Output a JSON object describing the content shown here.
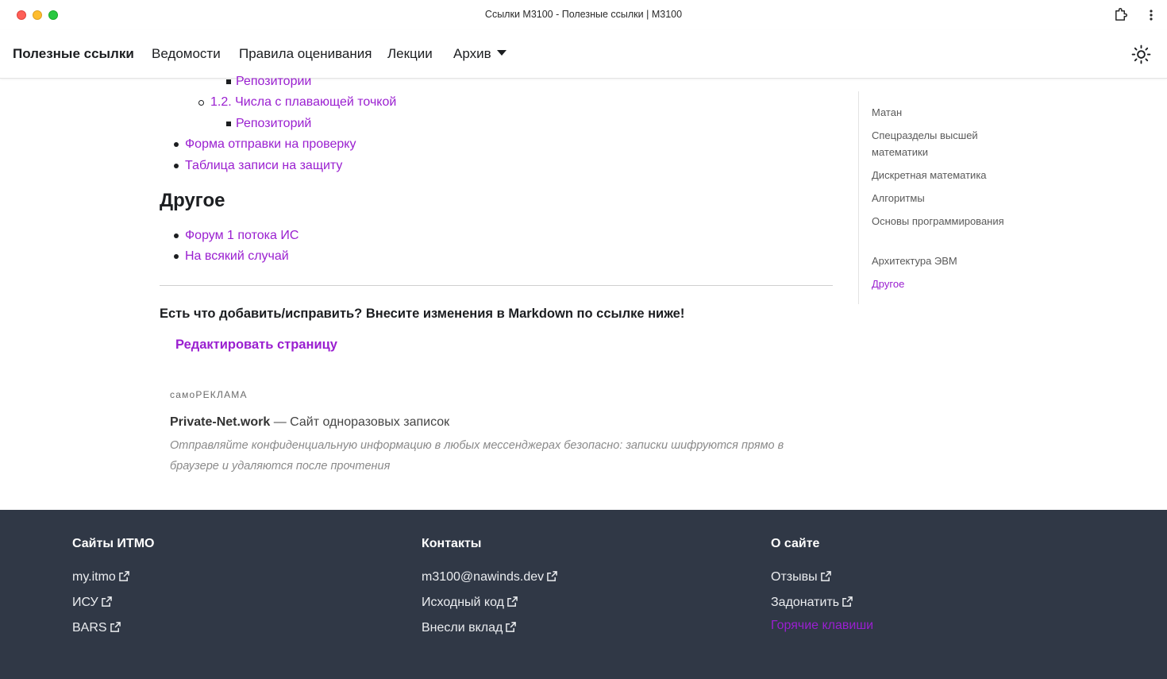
{
  "window": {
    "title": "Ссылки M3100 - Полезные ссылки | M3100"
  },
  "navbar": {
    "brand": "Полезные ссылки",
    "links": [
      {
        "label": "Ведомости"
      },
      {
        "label": "Правила оценивания"
      },
      {
        "label": "Лекции"
      },
      {
        "label": "Архив"
      }
    ]
  },
  "content": {
    "list_top": [
      {
        "label": "Репозитории",
        "level": 3
      },
      {
        "label": "1.2. Числа с плавающей точкой",
        "level": 2
      },
      {
        "label": "Репозиторий",
        "level": 3
      },
      {
        "label": "Форма отправки на проверку",
        "level": 1
      },
      {
        "label": "Таблица записи на защиту",
        "level": 1
      }
    ],
    "other_heading": "Другое",
    "other_list": [
      {
        "label": "Форум 1 потока ИС"
      },
      {
        "label": "На всякий случай"
      }
    ],
    "cta": "Есть что добавить/исправить? Внесите изменения в Markdown по ссылке ниже!",
    "edit_link": "Редактировать страницу",
    "ad": {
      "label": "самоРЕКЛАМА",
      "title_bold": "Private-Net.work",
      "title_rest": " — Сайт одноразовых записок",
      "description": "Отправляйте конфиденциальную информацию в любых мессенджерах безопасно: записки шифруются прямо в браузере и удаляются после прочтения"
    }
  },
  "toc": {
    "items": [
      {
        "label": "Матан"
      },
      {
        "label": "Спецразделы высшей математики"
      },
      {
        "label": "Дискретная математика"
      },
      {
        "label": "Алгоритмы"
      },
      {
        "label": "Основы программирования"
      },
      {
        "label": "Архитектура ЭВМ"
      },
      {
        "label": "Другое",
        "active": true
      }
    ]
  },
  "footer": {
    "columns": [
      {
        "title": "Сайты ИТМО",
        "links": [
          {
            "label": "my.itmo",
            "external": true
          },
          {
            "label": "ИСУ",
            "external": true
          },
          {
            "label": "BARS",
            "external": true
          }
        ]
      },
      {
        "title": "Контакты",
        "links": [
          {
            "label": "m3100@nawinds.dev",
            "external": true
          },
          {
            "label": "Исходный код",
            "external": true
          },
          {
            "label": "Внесли вклад",
            "external": true
          }
        ]
      },
      {
        "title": "О сайте",
        "links": [
          {
            "label": "Отзывы",
            "external": true
          },
          {
            "label": "Задонатить",
            "external": true
          },
          {
            "label": "Горячие клавиши",
            "external": false
          }
        ]
      }
    ]
  },
  "colors": {
    "link": "#9a1fd0",
    "footer_bg": "#303846",
    "text": "#1c1e21"
  },
  "icons": {
    "extensions": "puzzle-icon",
    "browser_menu": "kebab-menu-icon",
    "theme": "sun-icon",
    "external": "external-link-icon"
  }
}
